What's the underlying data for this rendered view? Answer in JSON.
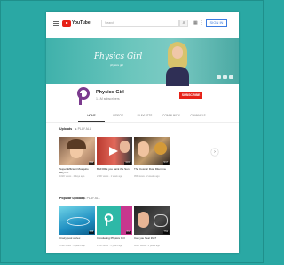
{
  "topbar": {
    "logo_text": "YouTube",
    "search_placeholder": "Search",
    "signin_label": "SIGN IN"
  },
  "banner": {
    "logo_text": "Physics Girl",
    "tagline": "physics girl"
  },
  "channel": {
    "name": "Physics Girl",
    "subscribers": "1.1M subscribers",
    "subscribe_label": "SUBSCRIBE",
    "logo_color": "#7b3a8e"
  },
  "tabs": [
    "HOME",
    "VIDEOS",
    "PLAYLISTS",
    "COMMUNITY",
    "CHANNELS"
  ],
  "sections": {
    "uploads_title": "Uploads",
    "uploads_play": "PLAY ALL",
    "popular_title": "Popular uploads",
    "popular_play": "PLAY ALL"
  },
  "uploads": [
    {
      "title": "Super-Efficient Mosquito Physics",
      "meta": "102K views · 2 days ago",
      "duration": "8:42"
    },
    {
      "title": "BEFORE you paint the Sun",
      "meta": "210K views · 1 week ago",
      "duration": "11:03"
    },
    {
      "title": "The Cosmic Dust Dilemma",
      "meta": "95K views · 2 weeks ago",
      "duration": "9:17"
    }
  ],
  "popular": [
    {
      "title": "Crazy pool vortex",
      "meta": "5.4M views · 3 years ago",
      "duration": "3:05"
    },
    {
      "title": "Introducing Physics Girl",
      "meta": "1.2M views · 5 years ago",
      "duration": "2:14"
    },
    {
      "title": "Can you hear this?",
      "meta": "900K views · 2 years ago",
      "duration": "7:51"
    }
  ],
  "colors": {
    "background": "#2aa8a4",
    "brand_red": "#e62117",
    "accent_blue": "#3c7be0"
  }
}
